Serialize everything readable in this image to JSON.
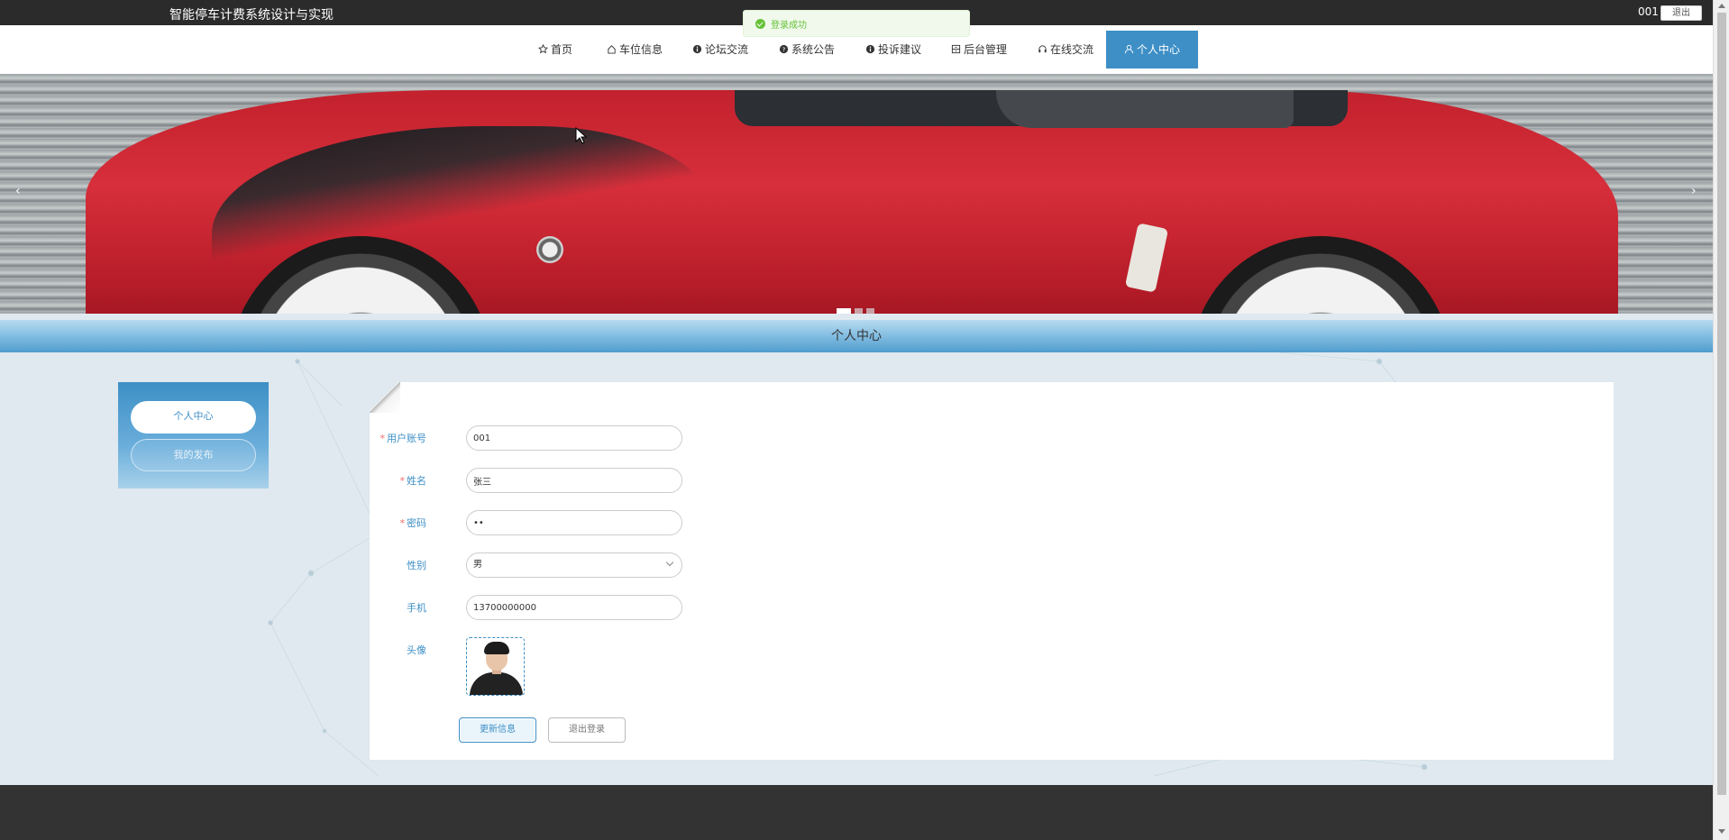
{
  "app": {
    "title": "智能停车计费系统设计与实现"
  },
  "topbar": {
    "username": "001",
    "logout_label": "退出"
  },
  "toast": {
    "message": "登录成功",
    "color": "#67c23a"
  },
  "nav": {
    "items": [
      {
        "label": "首页",
        "icon": "star-icon"
      },
      {
        "label": "车位信息",
        "icon": "home-icon"
      },
      {
        "label": "论坛交流",
        "icon": "info-circle-icon"
      },
      {
        "label": "系统公告",
        "icon": "question-circle-icon"
      },
      {
        "label": "投诉建议",
        "icon": "info-circle-icon"
      },
      {
        "label": "后台管理",
        "icon": "cabinet-icon"
      },
      {
        "label": "在线交流",
        "icon": "headset-icon"
      },
      {
        "label": "个人中心",
        "icon": "user-icon",
        "active": true
      }
    ]
  },
  "banner": {
    "prev": "‹",
    "next": "›",
    "slide_count": 3,
    "active_slide": 1
  },
  "section": {
    "title": "个人中心"
  },
  "sidebar": {
    "items": [
      {
        "label": "个人中心",
        "active": true
      },
      {
        "label": "我的发布",
        "active": false
      }
    ]
  },
  "form": {
    "fields": [
      {
        "label": "用户账号",
        "required": true,
        "value": "001"
      },
      {
        "label": "姓名",
        "required": true,
        "value": "张三"
      },
      {
        "label": "密码",
        "required": true,
        "value": "••"
      },
      {
        "label": "性别",
        "required": false,
        "value": "男"
      },
      {
        "label": "手机",
        "required": false,
        "value": "13700000000"
      },
      {
        "label": "头像",
        "required": false
      }
    ],
    "update_label": "更新信息",
    "logout_label": "退出登录"
  },
  "colors": {
    "accent": "#3d8fc6",
    "topbar": "#2b2b2b",
    "footer": "#333333",
    "required": "#f56c6c"
  }
}
